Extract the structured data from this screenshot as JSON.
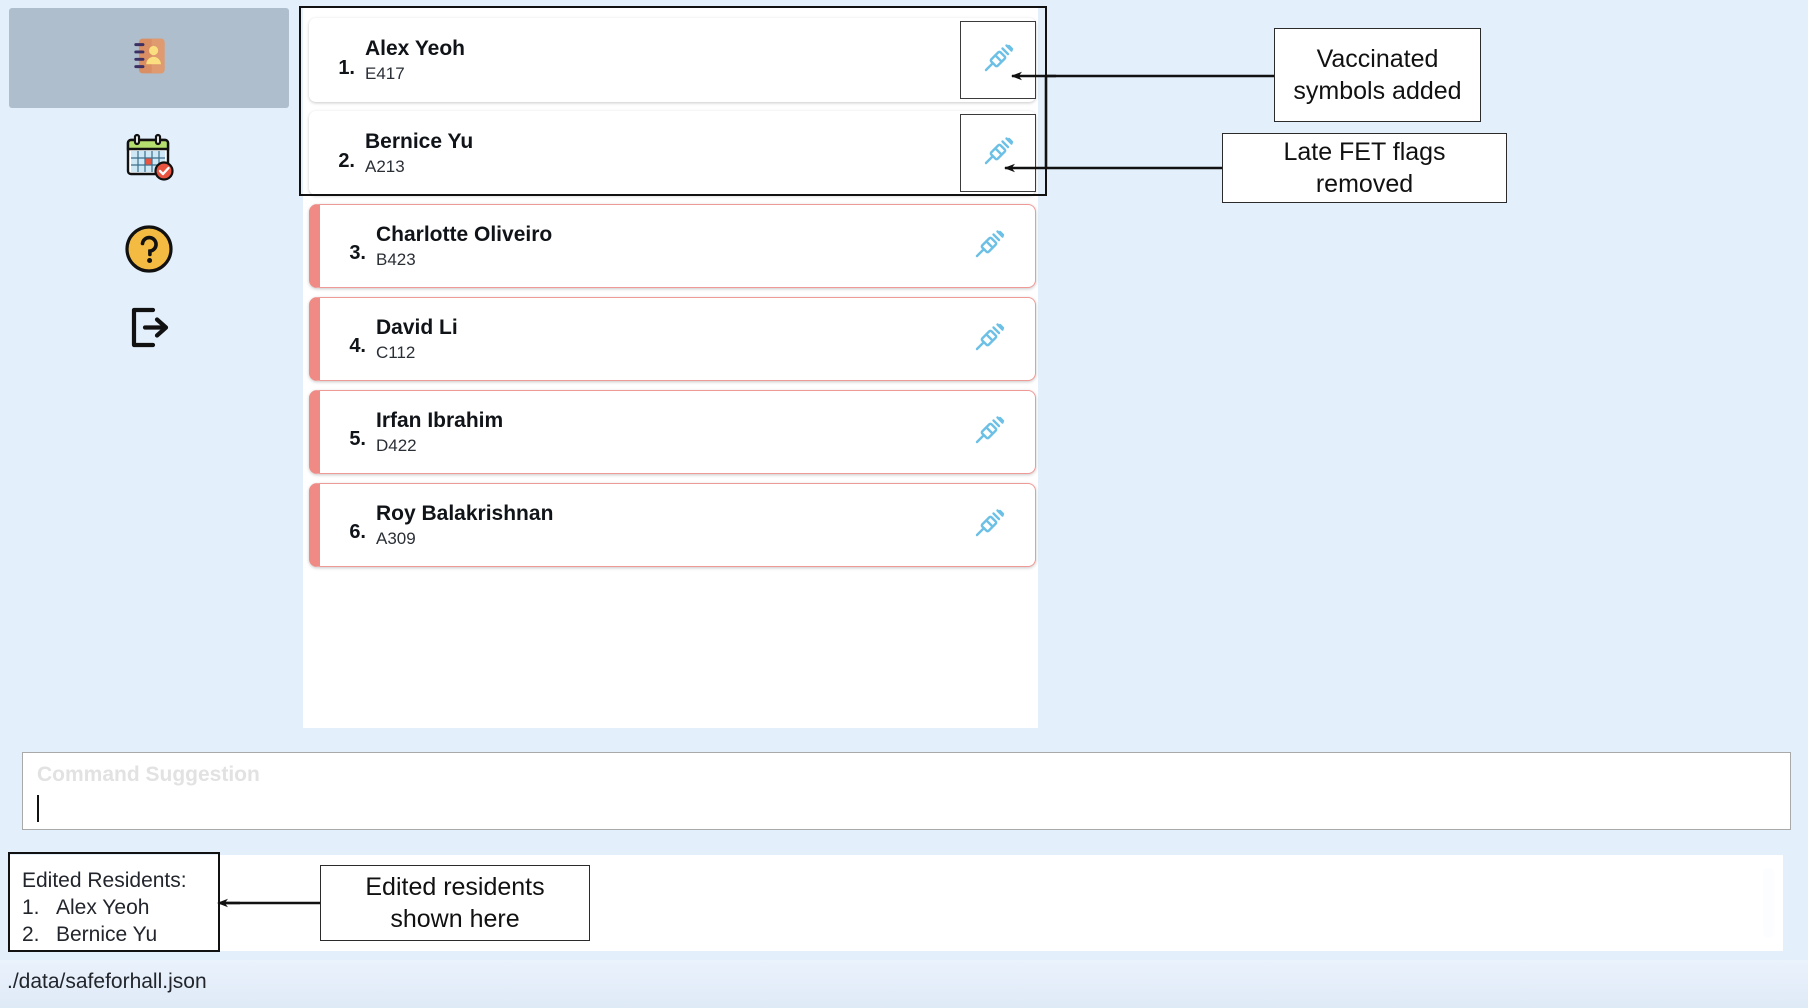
{
  "app": {
    "background_color": "#e3effb",
    "panel_color": "#ffffff",
    "flag_color": "#ef8a84",
    "vaccine_icon_color": "#6cc0e5",
    "selected_nav_color": "#afbecd"
  },
  "sidebar": {
    "items": [
      {
        "id": "contacts",
        "icon": "address-book-icon",
        "label": "Residents",
        "selected": true
      },
      {
        "id": "events",
        "icon": "calendar-check-icon",
        "label": "Events",
        "selected": false
      },
      {
        "id": "help",
        "icon": "help-circle-icon",
        "label": "Help",
        "selected": false
      },
      {
        "id": "exit",
        "icon": "logout-icon",
        "label": "Exit",
        "selected": false
      }
    ]
  },
  "residents": {
    "column_icon": "syringe-icon",
    "rows": [
      {
        "index": "1.",
        "name": "Alex Yeoh",
        "room": "E417",
        "flagged": false,
        "vaccinated": true,
        "highlighted": true
      },
      {
        "index": "2.",
        "name": "Bernice Yu",
        "room": "A213",
        "flagged": false,
        "vaccinated": true,
        "highlighted": true
      },
      {
        "index": "3.",
        "name": "Charlotte Oliveiro",
        "room": "B423",
        "flagged": true,
        "vaccinated": true,
        "highlighted": false
      },
      {
        "index": "4.",
        "name": "David Li",
        "room": "C112",
        "flagged": true,
        "vaccinated": true,
        "highlighted": false
      },
      {
        "index": "5.",
        "name": "Irfan Ibrahim",
        "room": "D422",
        "flagged": true,
        "vaccinated": true,
        "highlighted": false
      },
      {
        "index": "6.",
        "name": "Roy Balakrishnan",
        "room": "A309",
        "flagged": true,
        "vaccinated": true,
        "highlighted": false
      }
    ]
  },
  "command": {
    "placeholder": "Command Suggestion",
    "value": ""
  },
  "result": {
    "text": ""
  },
  "edited_residents": {
    "heading": "Edited Residents:",
    "items": [
      {
        "num": "1.",
        "name": "Alex Yeoh"
      },
      {
        "num": "2.",
        "name": "Bernice Yu"
      }
    ]
  },
  "status": {
    "file_path": "./data/safeforhall.json"
  },
  "annotations": [
    {
      "id": "vaccinated-symbols",
      "text": "Vaccinated\nsymbols added"
    },
    {
      "id": "late-fet-flags",
      "text": "Late FET flags removed"
    },
    {
      "id": "edited-residents",
      "text": "Edited residents\nshown here"
    }
  ]
}
